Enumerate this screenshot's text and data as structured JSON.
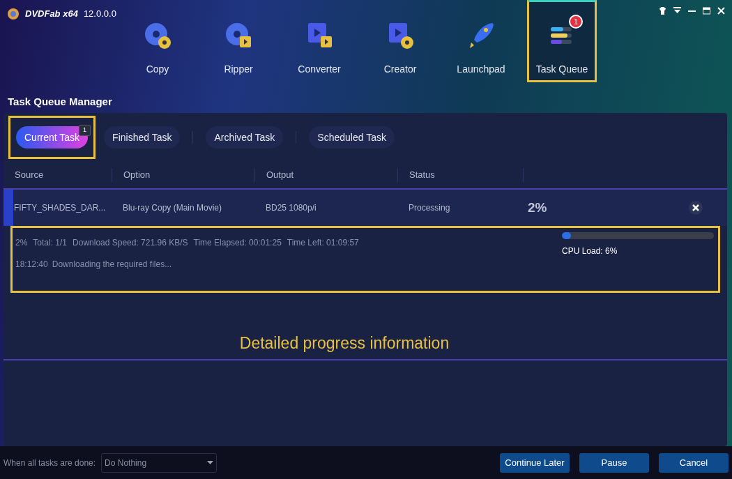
{
  "app": {
    "logo_text": "DVDFab x64",
    "version": "12.0.0.0"
  },
  "modules": [
    {
      "label": "Copy",
      "kind": "copy",
      "selected": false
    },
    {
      "label": "Ripper",
      "kind": "ripper",
      "selected": false
    },
    {
      "label": "Converter",
      "kind": "converter",
      "selected": false
    },
    {
      "label": "Creator",
      "kind": "creator",
      "selected": false
    },
    {
      "label": "Launchpad",
      "kind": "launchpad",
      "selected": false
    },
    {
      "label": "Task Queue",
      "kind": "queue",
      "selected": true,
      "badge": "1"
    }
  ],
  "section_title": "Task Queue Manager",
  "tabs": [
    {
      "label": "Current Task",
      "selected": true,
      "badge": "1"
    },
    {
      "label": "Finished Task",
      "selected": false
    },
    {
      "label": "Archived Task",
      "selected": false
    },
    {
      "label": "Scheduled Task",
      "selected": false
    }
  ],
  "table": {
    "columns": [
      "Source",
      "Option",
      "Output",
      "Status"
    ],
    "rows": [
      {
        "source": "FIFTY_SHADES_DAR...",
        "option": "Blu-ray Copy (Main Movie)",
        "output": "BD25 1080p/i",
        "status": "Processing",
        "percent": "2%",
        "selected": true
      }
    ]
  },
  "details": {
    "line_1": [
      "2%",
      "Total: 1/1",
      "Download Speed: 721.96 KB/S",
      "Time Elapsed: 00:01:25",
      "Time Left: 01:09:57"
    ],
    "line_2": [
      "18:12:40",
      "Downloading the required files..."
    ],
    "cpu": {
      "level": 0.06,
      "label": "CPU Load: 6%"
    }
  },
  "annotation": "Detailed progress information",
  "footer": {
    "label": "When all tasks are done:",
    "dropdown": "Do Nothing",
    "buttons": [
      "Continue Later",
      "Pause",
      "Cancel"
    ]
  }
}
